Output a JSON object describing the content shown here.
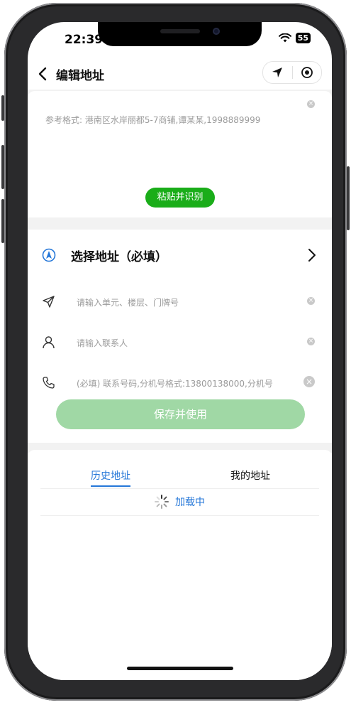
{
  "status_bar": {
    "time": "22:39",
    "battery": "55"
  },
  "header": {
    "title": "编辑地址"
  },
  "paste": {
    "hint": "参考格式: 港南区水岸丽都5-7商铺,谭某某,1998889999",
    "button_label": "粘贴并识别"
  },
  "form": {
    "select_address_label": "选择地址（必填）",
    "unit_placeholder": "请输入单元、楼层、门牌号",
    "contact_placeholder": "请输入联系人",
    "phone_placeholder": "(必填) 联系号码,分机号格式:13800138000,分机号",
    "save_label": "保存并使用"
  },
  "history": {
    "tabs": [
      {
        "label": "历史地址",
        "active": true
      },
      {
        "label": "我的地址",
        "active": false
      }
    ],
    "loading_text": "加载中"
  },
  "colors": {
    "accent_green": "#1aad19",
    "save_disabled": "#a0d8a5",
    "link_blue": "#2577d8"
  }
}
